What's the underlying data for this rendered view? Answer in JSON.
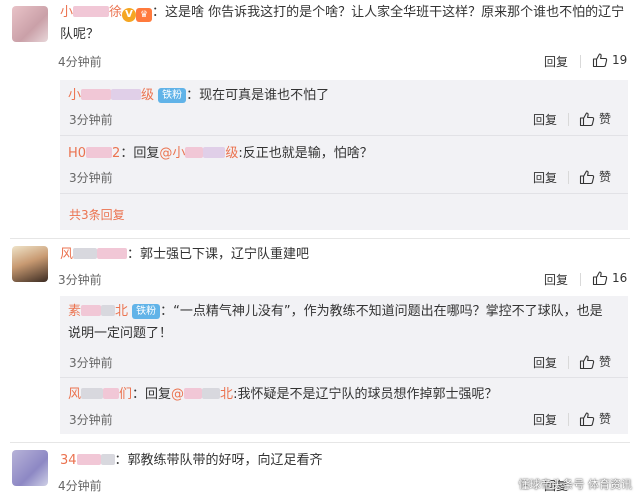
{
  "comments": [
    {
      "user_visible": "小",
      "user_tail": "徐",
      "text": "：这是啥 你告诉我这打的是个啥？让人家全华班干这样？原来那个谁也不怕的辽宁队呢？",
      "text_line1": "：这是啥 你告诉我这打的是个啥？让人家全华班干这样？原来那个谁也不怕的辽宁",
      "text_line2": "队呢？",
      "time": "4分钟前",
      "reply_label": "回复",
      "likes": "19",
      "replies": [
        {
          "user_head": "小",
          "user_tail": "级",
          "badge": "铁粉",
          "text": "：现在可真是谁也不怕了",
          "time": "3分钟前",
          "reply_label": "回复",
          "like_label": "赞"
        },
        {
          "user_head": "H0",
          "user_tail": "2",
          "reply_prefix": "：回复",
          "mention_head": "@小",
          "mention_tail": "级",
          "text": ":反正也就是输，怕啥？",
          "time": "3分钟前",
          "reply_label": "回复",
          "like_label": "赞"
        }
      ],
      "more_replies": "共3条回复"
    },
    {
      "user_head": "风",
      "text": "：郭士强已下课，辽宁队重建吧",
      "time": "3分钟前",
      "reply_label": "回复",
      "likes": "16",
      "replies": [
        {
          "user_head": "素",
          "user_tail": "北",
          "badge": "铁粉",
          "text_line1": "：“一点精气神儿没有”，作为教练不知道问题出在哪吗？掌控不了球队，也是",
          "text_line2": "说明一定问题了！",
          "time": "3分钟前",
          "reply_label": "回复",
          "like_label": "赞"
        },
        {
          "user_head": "风",
          "user_tail": "们",
          "reply_prefix": "：回复",
          "mention_head": "@",
          "mention_tail": "北",
          "text": ":我怀疑是不是辽宁队的球员想作掉郭士强呢？",
          "time": "3分钟前",
          "reply_label": "回复",
          "like_label": "赞"
        }
      ]
    },
    {
      "user_head": "34",
      "text": "：郭教练带队带的好呀，向辽足看齐",
      "time": "4分钟前",
      "reply_label": "回复"
    }
  ],
  "watermark": "懂球帝头条号 体育资讯",
  "colors": {
    "username": "#eb7350",
    "fan_badge": "#61b3e8",
    "sub_bg": "#f2f2f5",
    "time": "#666666"
  },
  "icons": [
    "thumb-up-icon",
    "verified-v-icon",
    "crown-badge-icon"
  ]
}
